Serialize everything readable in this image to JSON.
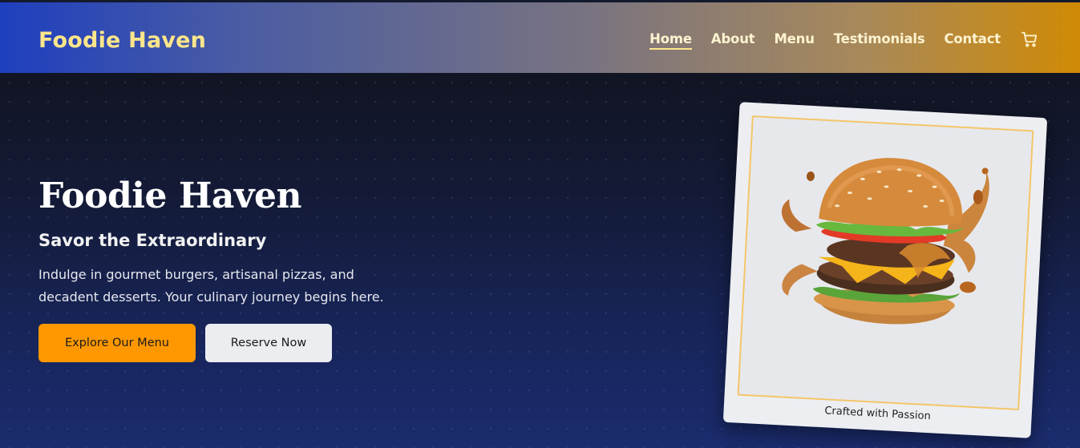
{
  "nav": {
    "brand": "Foodie Haven",
    "links": [
      "Home",
      "About",
      "Menu",
      "Testimonials",
      "Contact"
    ],
    "active": "Home",
    "cart_icon": "cart-icon"
  },
  "hero": {
    "title": "Foodie Haven",
    "subtitle": "Savor the Extraordinary",
    "description": "Indulge in gourmet burgers, artisanal pizzas, and decadent desserts. Your culinary journey begins here.",
    "primary_button": "Explore Our Menu",
    "secondary_button": "Reserve Now"
  },
  "card": {
    "image": "burger-image",
    "caption": "Crafted with Passion"
  },
  "colors": {
    "brand_yellow": "#fde68a",
    "accent_orange": "#ff9800",
    "nav_gradient_start": "#1e3fbf",
    "nav_gradient_end": "#d08a05",
    "hero_bg": "#18265e"
  }
}
